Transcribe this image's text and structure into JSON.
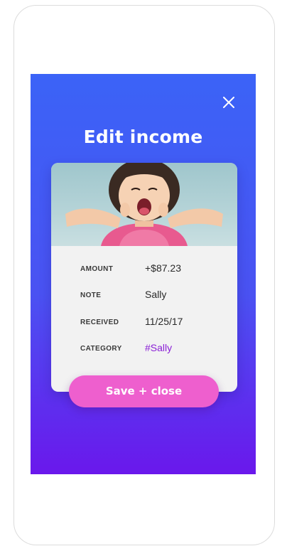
{
  "screen": {
    "title": "Edit income",
    "close_icon": "close-icon"
  },
  "photo": {
    "subject": "child-making-face-photo"
  },
  "fields": [
    {
      "label": "AMOUNT",
      "value": "+$87.23"
    },
    {
      "label": "NOTE",
      "value": "Sally"
    },
    {
      "label": "RECEIVED",
      "value": "11/25/17"
    },
    {
      "label": "CATEGORY",
      "value": "#Sally"
    }
  ],
  "actions": {
    "save_label": "Save + close"
  },
  "colors": {
    "gradient_top": "#3b63f7",
    "gradient_bottom": "#6a18ec",
    "save_button": "#ee5fce",
    "category_tag": "#8a1fd6",
    "card_background": "#f2f2f2"
  }
}
